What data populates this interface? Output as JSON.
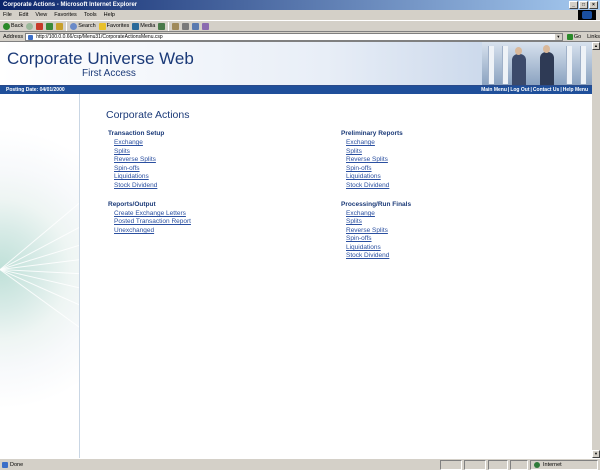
{
  "window": {
    "title": "Corporate Actions - Microsoft Internet Explorer"
  },
  "menu": [
    "File",
    "Edit",
    "View",
    "Favorites",
    "Tools",
    "Help"
  ],
  "toolbar": {
    "back": "Back",
    "search": "Search",
    "favorites": "Favorites",
    "media": "Media"
  },
  "address": {
    "label": "Address",
    "url": "http://100.0.0.66/csp/Menu31/CorporateActionsMenu.csp",
    "go": "Go",
    "links": "Links"
  },
  "banner": {
    "line1": "Corporate Universe Web",
    "line2": "First Access"
  },
  "nav": {
    "posting_date": "Posting Date: 04/01/2000",
    "links": [
      "Main Menu",
      "Log Out",
      "Contact Us",
      "Help Menu"
    ],
    "separator": "|"
  },
  "page": {
    "title": "Corporate Actions",
    "sections": [
      {
        "title": "Transaction Setup",
        "links": [
          "Exchange",
          "Splits",
          "Reverse Splits",
          "Spin-offs",
          "Liquidations",
          "Stock Dividend"
        ]
      },
      {
        "title": "Reports/Output",
        "links": [
          "Create Exchange Letters",
          "Posted Transaction Report",
          "Unexchanged"
        ]
      },
      {
        "title": "Preliminary Reports",
        "links": [
          "Exchange",
          "Splits",
          "Reverse Splits",
          "Spin-offs",
          "Liquidations",
          "Stock Dividend"
        ]
      },
      {
        "title": "Processing/Run Finals",
        "links": [
          "Exchange",
          "Splits",
          "Reverse Splits",
          "Spin-offs",
          "Liquidations",
          "Stock Dividend"
        ]
      }
    ]
  },
  "status": {
    "left": "Done",
    "zone": "Internet"
  }
}
